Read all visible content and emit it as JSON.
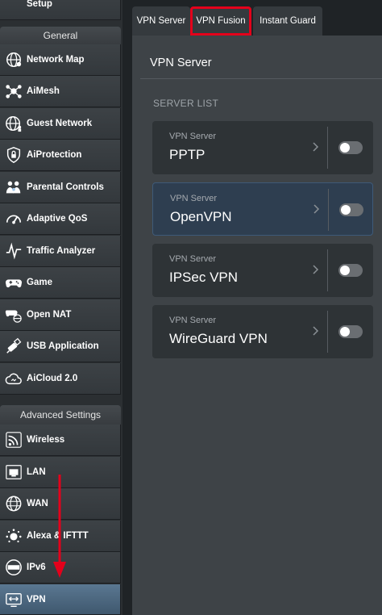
{
  "sidebar": {
    "top_item": {
      "label": "Setup",
      "icon": "setup-icon"
    },
    "general_header": "General",
    "general_items": [
      {
        "label": "Network Map",
        "icon": "globe-icon"
      },
      {
        "label": "AiMesh",
        "icon": "mesh-icon"
      },
      {
        "label": "Guest Network",
        "icon": "guest-globe-icon"
      },
      {
        "label": "AiProtection",
        "icon": "shield-lock-icon"
      },
      {
        "label": "Parental Controls",
        "icon": "family-icon"
      },
      {
        "label": "Adaptive QoS",
        "icon": "speedometer-icon"
      },
      {
        "label": "Traffic Analyzer",
        "icon": "pulse-icon"
      },
      {
        "label": "Game",
        "icon": "gamepad-icon"
      },
      {
        "label": "Open NAT",
        "icon": "gamepad-globe-icon"
      },
      {
        "label": "USB Application",
        "icon": "usb-icon"
      },
      {
        "label": "AiCloud 2.0",
        "icon": "cloud-icon"
      }
    ],
    "advanced_header": "Advanced Settings",
    "advanced_items": [
      {
        "label": "Wireless",
        "icon": "wifi-icon"
      },
      {
        "label": "LAN",
        "icon": "lan-icon"
      },
      {
        "label": "WAN",
        "icon": "wan-globe-icon"
      },
      {
        "label": "Alexa & IFTTT",
        "icon": "alexa-icon"
      },
      {
        "label": "IPv6",
        "icon": "ipv6-icon"
      },
      {
        "label": "VPN",
        "icon": "vpn-icon"
      }
    ]
  },
  "tabs": [
    {
      "label": "VPN Server"
    },
    {
      "label": "VPN Fusion"
    },
    {
      "label": "Instant Guard"
    }
  ],
  "panel": {
    "title": "VPN Server",
    "section_label": "SERVER LIST",
    "servers": [
      {
        "category": "VPN Server",
        "name": "PPTP"
      },
      {
        "category": "VPN Server",
        "name": "OpenVPN"
      },
      {
        "category": "VPN Server",
        "name": "IPSec VPN"
      },
      {
        "category": "VPN Server",
        "name": "WireGuard VPN"
      }
    ]
  },
  "colors": {
    "highlight_box": "#e4001b",
    "annotation_arrow": "#e4001b",
    "active_nav": "#4d6a84"
  }
}
